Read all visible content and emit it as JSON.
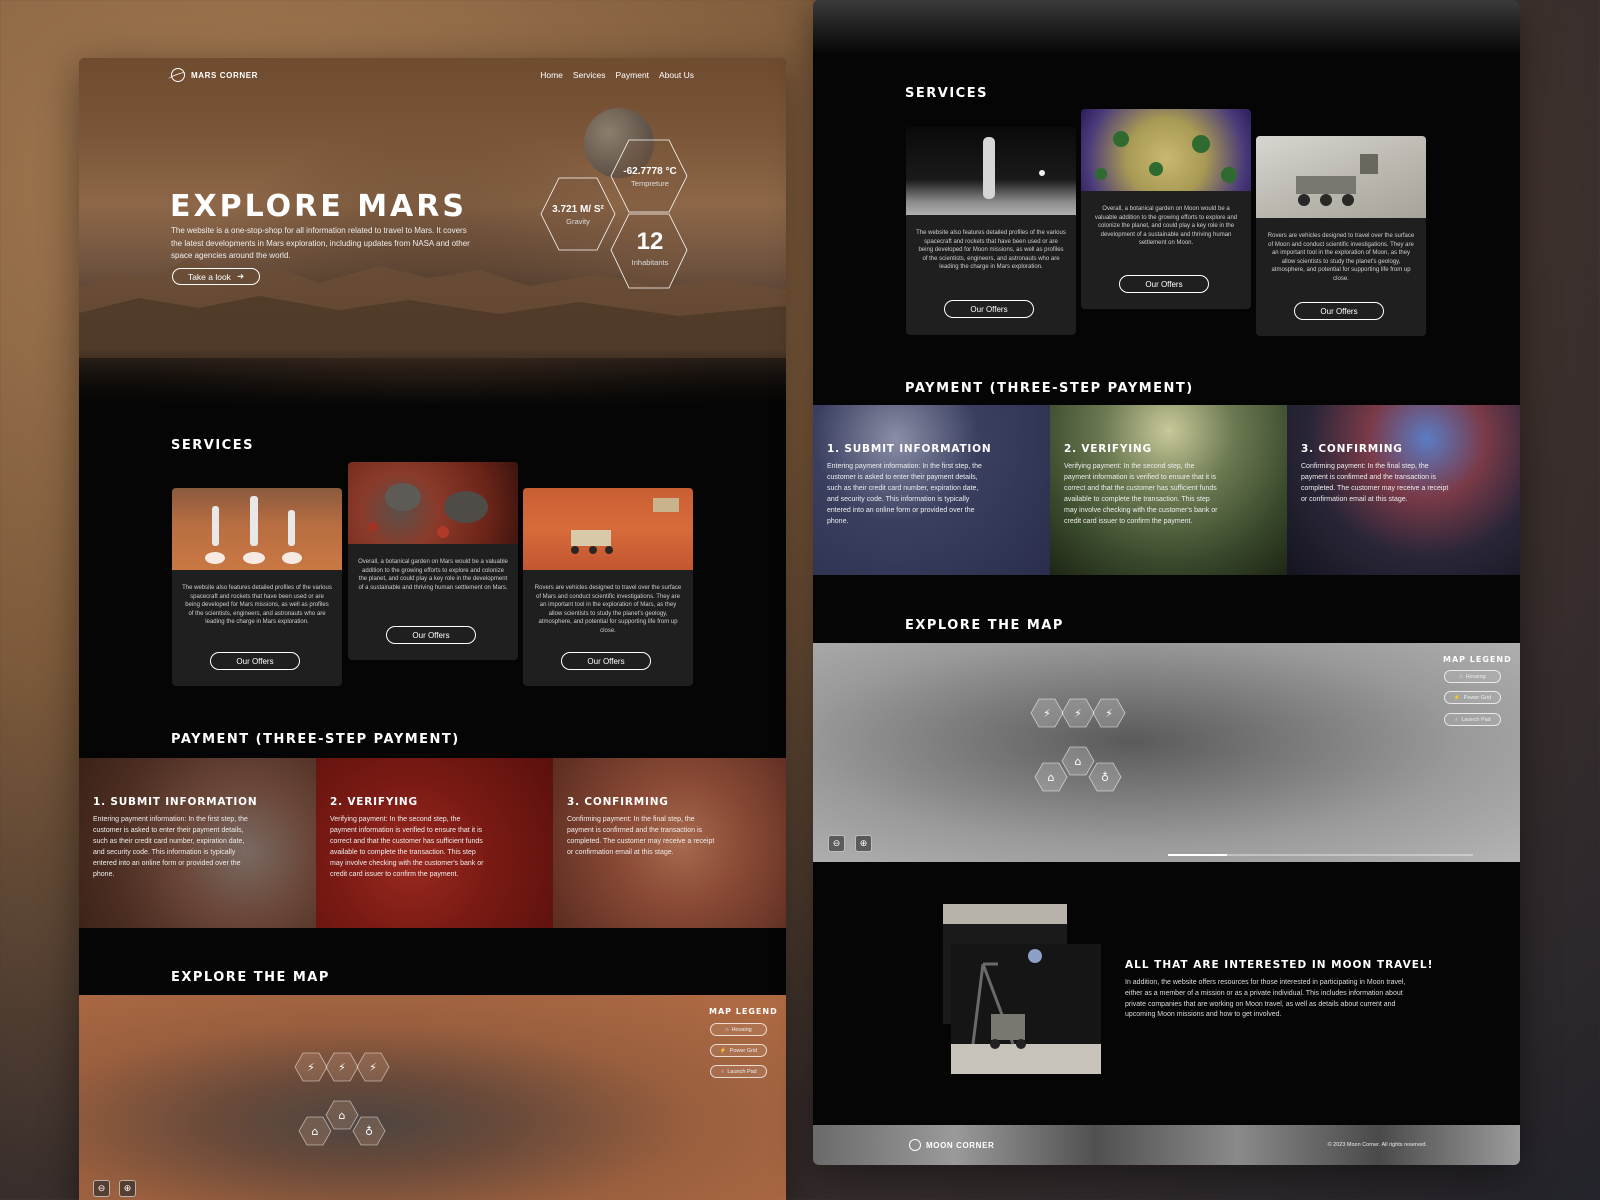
{
  "mars": {
    "brand": "MARS CORNER",
    "nav": [
      "Home",
      "Services",
      "Payment",
      "About Us"
    ],
    "hero": {
      "title": "EXPLORE MARS",
      "description": "The website is a one-stop-shop for all information related to travel to Mars. It covers the latest developments in Mars exploration, including updates from NASA and other space agencies around the world.",
      "button": "Take a look"
    },
    "stats": {
      "temperature_value": "-62.7778 °C",
      "temperature_label": "Tempreture",
      "gravity_value": "3.721 M/ S²",
      "gravity_label": "Gravity",
      "inhabitants_value": "12",
      "inhabitants_label": "Inhabitants"
    },
    "services": {
      "title": "SERVICES",
      "cards": [
        {
          "text": "The website also features detailed profiles of the various spacecraft and rockets that have been used or are being developed for Mars missions, as well as profiles of the scientists, engineers, and astronauts who are leading the charge in Mars exploration.",
          "button": "Our Offers"
        },
        {
          "text": "Overall, a botanical garden on Mars would be a valuable addition to the growing efforts to explore and colonize the planet, and could play a key role in the development of a sustainable and thriving human settlement on Mars.",
          "button": "Our Offers"
        },
        {
          "text": "Rovers are vehicles designed to travel over the surface of Mars and conduct scientific investigations. They are an important tool in the exploration of Mars, as they allow scientists to study the planet's geology, atmosphere, and potential for supporting life from up close.",
          "button": "Our Offers"
        }
      ]
    },
    "payment": {
      "title": "PAYMENT (THREE-STEP PAYMENT)",
      "steps": [
        {
          "title": "1. SUBMIT INFORMATION",
          "text": "Entering payment information: In the first step, the customer is asked to enter their payment details, such as their credit card number, expiration date, and security code. This information is typically entered into an online form or provided over the phone."
        },
        {
          "title": "2. VERIFYING",
          "text": "Verifying payment: In the second step, the payment information is verified to ensure that it is correct and that the customer has sufficient funds available to complete the transaction. This step may involve checking with the customer's bank or credit card issuer to confirm the payment."
        },
        {
          "title": "3. CONFIRMING",
          "text": "Confirming payment: In the final step, the payment is confirmed and the transaction is completed. The customer may receive a receipt or confirmation email at this stage."
        }
      ]
    },
    "map": {
      "title": "EXPLORE THE MAP",
      "legend_title": "MAP LEGEND",
      "legend": [
        "Housing",
        "Power Grid",
        "Launch Pad"
      ]
    }
  },
  "moon": {
    "services": {
      "title": "SERVICES",
      "cards": [
        {
          "text": "The website also features detailed profiles of the various spacecraft and rockets that have been used or are being developed for Moon missions, as well as profiles of the scientists, engineers, and astronauts who are leading the charge in Mars exploration.",
          "button": "Our Offers"
        },
        {
          "text": "Overall, a botanical garden on Moon would be a valuable addition to the growing efforts to explore and colonize the planet, and could play a key role in the development of a sustainable and thriving human settlement on Moon.",
          "button": "Our Offers"
        },
        {
          "text": "Rovers are vehicles designed to travel over the surface of Moon and conduct scientific investigations. They are an important tool in the exploration of Moon, as they allow scientists to study the planet's geology, atmosphere, and potential for supporting life from up close.",
          "button": "Our Offers"
        }
      ]
    },
    "payment": {
      "title": "PAYMENT (THREE-STEP PAYMENT)",
      "steps": [
        {
          "title": "1. SUBMIT INFORMATION",
          "text": "Entering payment information: In the first step, the customer is asked to enter their payment details, such as their credit card number, expiration date, and security code. This information is typically entered into an online form or provided over the phone."
        },
        {
          "title": "2. VERIFYING",
          "text": "Verifying payment: In the second step, the payment information is verified to ensure that it is correct and that the customer has sufficient funds available to complete the transaction. This step may involve checking with the customer's bank or credit card issuer to confirm the payment."
        },
        {
          "title": "3. CONFIRMING",
          "text": "Confirming payment: In the final step, the payment is confirmed and the transaction is completed. The customer may receive a receipt or confirmation email at this stage."
        }
      ]
    },
    "map": {
      "title": "EXPLORE THE MAP",
      "legend_title": "MAP LEGEND",
      "legend": [
        "Housing",
        "Power Grid",
        "Launch Pad"
      ]
    },
    "travel": {
      "title": "ALL THAT ARE INTERESTED IN MOON TRAVEL!",
      "text": "In addition, the website offers resources for those interested in participating in Moon travel, either as a member of a mission or as a private individual. This includes information about private companies that are working on Moon travel, as well as details about current and upcoming Moon missions and how to get involved."
    },
    "footer": {
      "brand": "MOON CORNER",
      "copyright": "© 2023 Moon Corner. All rights reserved."
    }
  }
}
